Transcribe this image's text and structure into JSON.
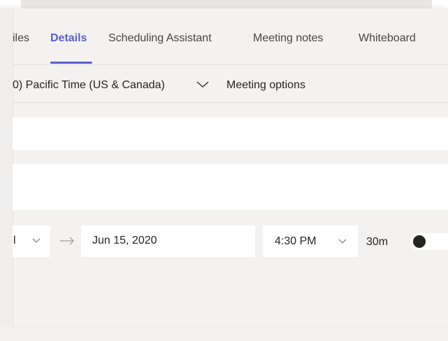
{
  "tabs": [
    {
      "label": "Files",
      "display": "iles",
      "active": false
    },
    {
      "label": "Details",
      "active": true
    },
    {
      "label": "Scheduling Assistant",
      "active": false
    },
    {
      "label": "Meeting notes",
      "active": false
    },
    {
      "label": "Whiteboard",
      "active": false
    }
  ],
  "timezone": {
    "value": "0) Pacific Time (US & Canada)"
  },
  "meeting_options": {
    "label": "Meeting options"
  },
  "title_field": {
    "value": ""
  },
  "location_field": {
    "value": ""
  },
  "schedule": {
    "start_time_fragment": "l",
    "end_date": "Jun 15, 2020",
    "end_time": "4:30 PM",
    "duration": "30m",
    "all_day_toggle": {
      "on": false
    }
  },
  "colors": {
    "accent": "#5b5fc7",
    "panel_bg": "#f3f2f1",
    "text": "#252423"
  }
}
